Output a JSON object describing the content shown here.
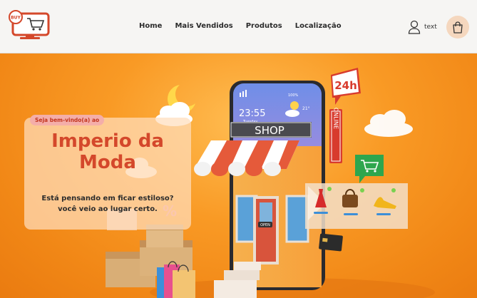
{
  "navbar": {
    "logo_text": "BUY",
    "links": [
      {
        "label": "Home"
      },
      {
        "label": "Mais Vendidos"
      },
      {
        "label": "Produtos"
      },
      {
        "label": "Localização"
      }
    ],
    "user_label": "text"
  },
  "hero": {
    "badge": "Seja bem-vindo(a) ao",
    "title_line1": "Imperio da",
    "title_line2": "Moda",
    "subtitle_line1": "Está pensando em ficar estiloso?",
    "subtitle_line2": "você veio ao lugar certo."
  },
  "phone": {
    "time": "23:55",
    "day": "Tuesday",
    "battery": "100%",
    "temperature": "21°",
    "shop_sign": "SHOP",
    "open_sign": "OPEN",
    "online_sign": "ONLINE",
    "hours_badge": "24h"
  },
  "colors": {
    "accent": "#d4482b",
    "background": "#f78f1e",
    "navbar": "#f6f5f3",
    "bag_button": "#f5d7be"
  }
}
